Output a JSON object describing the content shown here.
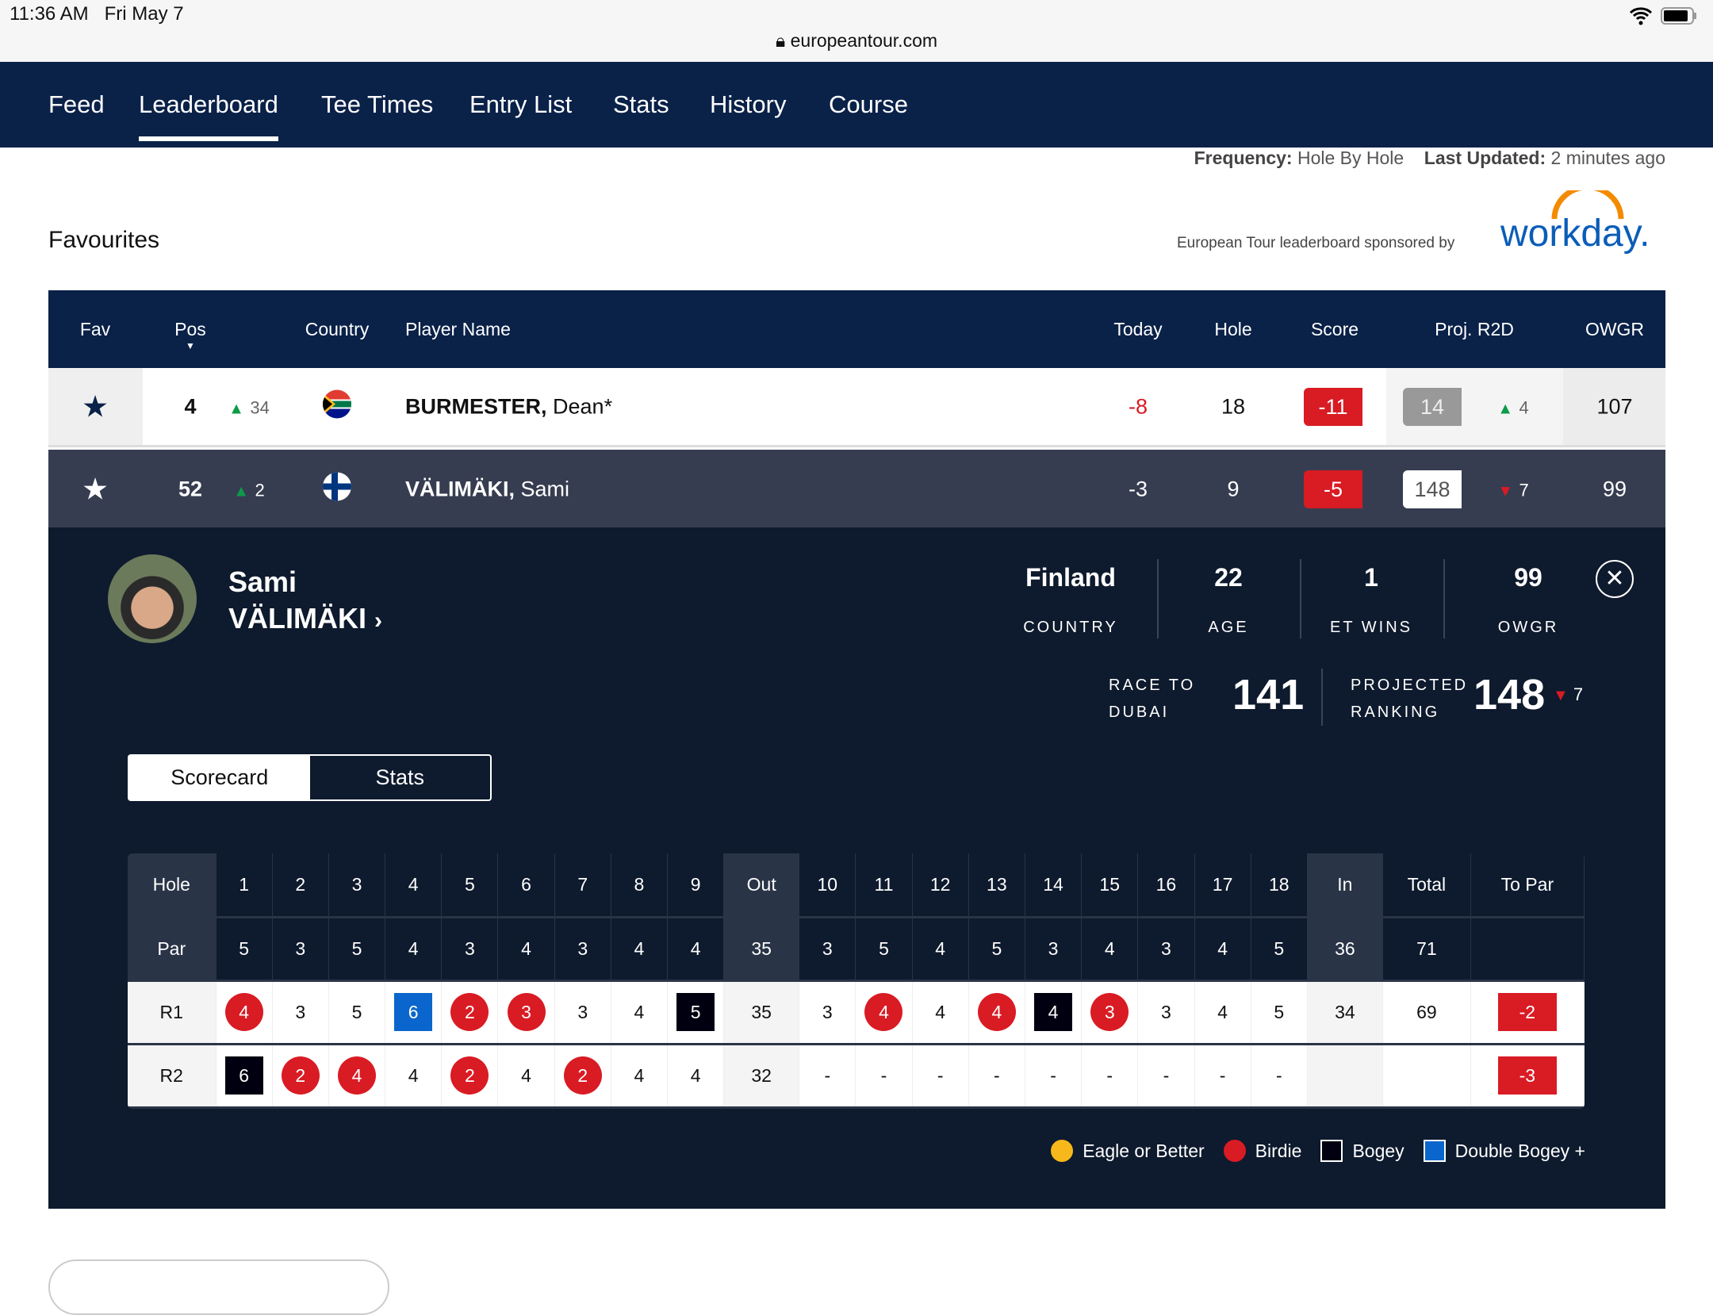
{
  "status": {
    "time": "11:36 AM",
    "date": "Fri May 7",
    "url": "europeantour.com"
  },
  "nav": {
    "items": [
      "Feed",
      "Leaderboard",
      "Tee Times",
      "Entry List",
      "Stats",
      "History",
      "Course"
    ],
    "active": "Leaderboard"
  },
  "meta": {
    "frequency_label": "Frequency:",
    "frequency": "Hole By Hole",
    "updated_label": "Last Updated:",
    "updated": "2 minutes ago"
  },
  "favourites_title": "Favourites",
  "sponsor": {
    "text": "European Tour leaderboard sponsored by",
    "logo": "workday."
  },
  "columns": {
    "fav": "Fav",
    "pos": "Pos",
    "country": "Country",
    "player": "Player Name",
    "today": "Today",
    "hole": "Hole",
    "score": "Score",
    "proj": "Proj. R2D",
    "owgr": "OWGR"
  },
  "players": [
    {
      "pos": "4",
      "move": "34",
      "move_dir": "up",
      "country": "South Africa",
      "surname": "BURMESTER,",
      "first": "Dean*",
      "today": "-8",
      "hole": "18",
      "score": "-11",
      "proj": "14",
      "proj_move": "4",
      "proj_dir": "up",
      "owgr": "107"
    },
    {
      "pos": "52",
      "move": "2",
      "move_dir": "up",
      "country": "Finland",
      "surname": "VÄLIMÄKI,",
      "first": "Sami",
      "today": "-3",
      "hole": "9",
      "score": "-5",
      "proj": "148",
      "proj_move": "7",
      "proj_dir": "down",
      "owgr": "99"
    }
  ],
  "profile": {
    "first": "Sami",
    "last": "VÄLIMÄKI",
    "country": "Finland",
    "country_label": "COUNTRY",
    "age": "22",
    "age_label": "AGE",
    "wins": "1",
    "wins_label": "ET WINS",
    "owgr": "99",
    "owgr_label": "OWGR",
    "r2d_label1": "RACE TO",
    "r2d_label2": "DUBAI",
    "r2d": "141",
    "proj_label1": "PROJECTED",
    "proj_label2": "RANKING",
    "proj": "148",
    "proj_move": "7"
  },
  "tabs": [
    "Scorecard",
    "Stats"
  ],
  "scorecard": {
    "header": [
      "Hole",
      "1",
      "2",
      "3",
      "4",
      "5",
      "6",
      "7",
      "8",
      "9",
      "Out",
      "10",
      "11",
      "12",
      "13",
      "14",
      "15",
      "16",
      "17",
      "18",
      "In",
      "Total",
      "To Par"
    ],
    "par": [
      "Par",
      "5",
      "3",
      "5",
      "4",
      "3",
      "4",
      "3",
      "4",
      "4",
      "35",
      "3",
      "5",
      "4",
      "5",
      "3",
      "4",
      "3",
      "4",
      "5",
      "36",
      "71",
      ""
    ],
    "rounds": [
      {
        "cells": [
          "R1",
          "4",
          "3",
          "5",
          "6",
          "2",
          "3",
          "3",
          "4",
          "5",
          "35",
          "3",
          "4",
          "4",
          "4",
          "4",
          "3",
          "3",
          "4",
          "5",
          "34",
          "69",
          "-2"
        ],
        "types": [
          "",
          "birdie",
          "",
          "",
          "double",
          "birdie",
          "birdie",
          "",
          "",
          "bogey",
          "",
          "",
          "birdie",
          "",
          "birdie",
          "bogey",
          "birdie",
          "",
          "",
          "",
          "",
          "",
          "topar"
        ]
      },
      {
        "cells": [
          "R2",
          "6",
          "2",
          "4",
          "4",
          "2",
          "4",
          "2",
          "4",
          "4",
          "32",
          "-",
          "-",
          "-",
          "-",
          "-",
          "-",
          "-",
          "-",
          "-",
          "",
          "",
          "-3"
        ],
        "types": [
          "",
          "bogey",
          "birdie",
          "birdie",
          "",
          "birdie",
          "",
          "birdie",
          "",
          "",
          "",
          "",
          "",
          "",
          "",
          "",
          "",
          "",
          "",
          "",
          "",
          "",
          "topar"
        ]
      }
    ]
  },
  "legend": [
    {
      "label": "Eagle or Better",
      "color": "#f6b81a"
    },
    {
      "label": "Birdie",
      "color": "#d91b24"
    },
    {
      "label": "Bogey",
      "color": "#000010"
    },
    {
      "label": "Double Bogey +",
      "color": "#0a66cc"
    }
  ],
  "colors": {
    "navy": "#0a2148",
    "red": "#d91b24",
    "green": "#0e9b47",
    "blue": "#0a66cc"
  }
}
